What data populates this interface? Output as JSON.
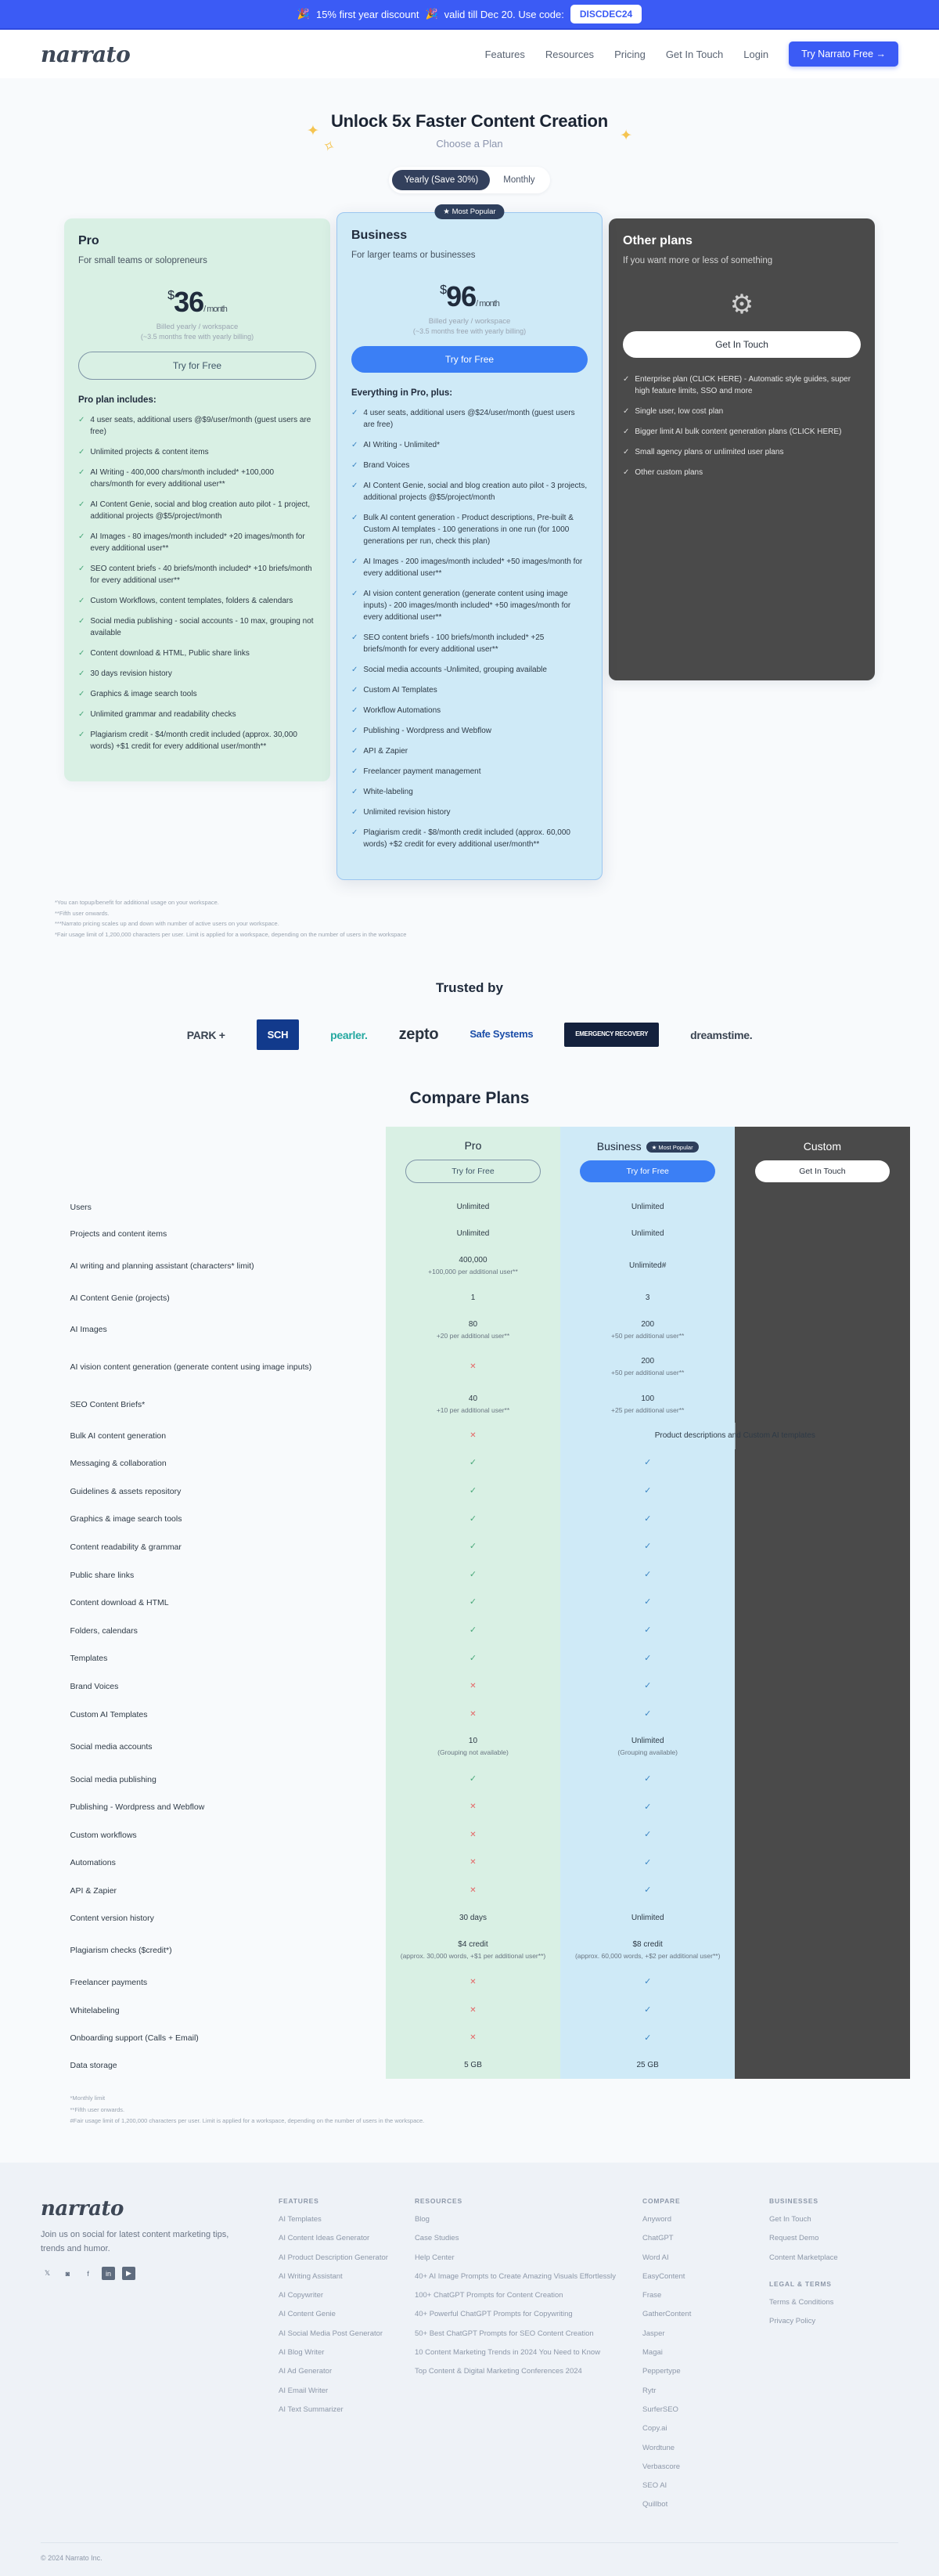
{
  "announcement": {
    "emoji_left": "🎉",
    "text_before": "15% first year discount",
    "emoji_right": "🎉",
    "text_after": "valid till Dec 20. Use code:",
    "code": "DISCDEC24"
  },
  "nav": {
    "logo": "narrato",
    "links": [
      "Features",
      "Resources",
      "Pricing",
      "Get In Touch",
      "Login"
    ],
    "cta": "Try Narrato Free →"
  },
  "hero": {
    "title": "Unlock 5x Faster Content Creation",
    "subtitle": "Choose a Plan",
    "toggle": {
      "yearly": "Yearly (Save 30%)",
      "monthly": "Monthly",
      "active": "yearly"
    }
  },
  "plans": [
    {
      "name": "Pro",
      "tagline": "For small teams or solopreneurs",
      "currency": "$",
      "price": "36",
      "per": "/ month",
      "billed": "Billed yearly / workspace",
      "billed_note": "(~3.5 months free with yearly billing)",
      "cta": "Try for Free",
      "includes_title": "Pro plan includes:",
      "features": [
        "4 user seats, additional users @$9/user/month (guest users are free)",
        "Unlimited projects & content items",
        "AI Writing - 400,000 chars/month included* +100,000 chars/month for every additional user**",
        "AI Content Genie, social and blog creation auto pilot - 1 project, additional projects @$5/project/month",
        "AI Images - 80 images/month included* +20 images/month for every additional user**",
        "SEO content briefs - 40 briefs/month included* +10 briefs/month for every additional user**",
        "Custom Workflows, content templates, folders & calendars",
        "Social media publishing - social accounts - 10 max, grouping not available",
        "Content download & HTML, Public share links",
        "30 days revision history",
        "Graphics & image search tools",
        "Unlimited grammar and readability checks",
        "Plagiarism credit - $4/month credit included (approx. 30,000 words) +$1 credit for every additional user/month**"
      ]
    },
    {
      "name": "Business",
      "badge": "★ Most Popular",
      "tagline": "For larger teams or businesses",
      "currency": "$",
      "price": "96",
      "per": "/ month",
      "billed": "Billed yearly / workspace",
      "billed_note": "(~3.5 months free with yearly billing)",
      "cta": "Try for Free",
      "includes_title": "Everything in Pro, plus:",
      "features": [
        "4 user seats, additional users @$24/user/month (guest users are free)",
        "AI Writing - Unlimited*",
        "Brand Voices",
        "AI Content Genie, social and blog creation auto pilot - 3 projects, additional projects @$5/project/month",
        "Bulk AI content generation - Product descriptions, Pre-built & Custom AI templates - 100 generations in one run (for 1000 generations per run, check this plan)",
        "AI Images - 200 images/month included* +50 images/month for every additional user**",
        "AI vision content generation (generate content using image inputs) - 200 images/month included* +50 images/month for every additional user**",
        "SEO content briefs - 100 briefs/month included* +25 briefs/month for every additional user**",
        "Social media accounts -Unlimited, grouping available",
        "Custom AI Templates",
        "Workflow Automations",
        "Publishing - Wordpress and Webflow",
        "API & Zapier",
        "Freelancer payment management",
        "White-labeling",
        "Unlimited revision history",
        "Plagiarism credit - $8/month credit included (approx. 60,000 words) +$2 credit for every additional user/month**"
      ]
    },
    {
      "name": "Other plans",
      "tagline": "If you want more or less of something",
      "cta": "Get In Touch",
      "features": [
        "Enterprise plan (CLICK HERE) - Automatic style guides, super high feature limits, SSO and more",
        "Single user, low cost plan",
        "Bigger limit AI bulk content generation plans (CLICK HERE)",
        "Small agency plans or unlimited user plans",
        "Other custom plans"
      ]
    }
  ],
  "plan_notes": [
    "*You can topup/benefit for additional usage on your workspace.",
    "**Fifth user onwards.",
    "***Narrato pricing scales up and down with number of active users on your workspace.",
    "*Fair usage limit of 1,200,000 characters per user. Limit is applied for a workspace, depending on the number of users in the workspace"
  ],
  "trusted": {
    "title": "Trusted by",
    "logos": [
      "PARK +",
      "SCH",
      "pearler.",
      "zepto",
      "Safe Systems",
      "EMERGENCY RECOVERY",
      "dreamstime."
    ]
  },
  "compare": {
    "title": "Compare Plans",
    "columns": [
      {
        "name": "Pro",
        "cta": "Try for Free",
        "style": "pro"
      },
      {
        "name": "Business",
        "badge": "★ Most Popular",
        "cta": "Try for Free",
        "style": "bus"
      },
      {
        "name": "Custom",
        "cta": "Get In Touch",
        "style": "oth"
      }
    ],
    "rows": [
      {
        "label": "Users",
        "pro": "Unlimited",
        "bus": "Unlimited",
        "oth": ""
      },
      {
        "label": "Projects and content items",
        "pro": "Unlimited",
        "bus": "Unlimited",
        "oth": ""
      },
      {
        "label": "AI writing and planning assistant (characters* limit)",
        "pro": "400,000",
        "pro_sub": "+100,000 per additional user**",
        "bus": "Unlimited#",
        "oth": ""
      },
      {
        "label": "AI Content Genie (projects)",
        "pro": "1",
        "bus": "3",
        "oth": ""
      },
      {
        "label": "AI Images",
        "pro": "80",
        "pro_sub": "+20 per additional user**",
        "bus": "200",
        "bus_sub": "+50 per additional user**",
        "oth": ""
      },
      {
        "label": "AI vision content generation (generate content using image inputs)",
        "pro": "cross",
        "bus": "200",
        "bus_sub": "+50 per additional user**",
        "oth": ""
      },
      {
        "label": "SEO Content Briefs*",
        "pro": "40",
        "pro_sub": "+10 per additional user**",
        "bus": "100",
        "bus_sub": "+25 per additional user**",
        "oth": ""
      },
      {
        "label": "Bulk AI content generation",
        "pro": "cross",
        "bus": "Product descriptions and Custom AI templates",
        "bus_span": true,
        "oth": ""
      },
      {
        "label": "Messaging & collaboration",
        "pro": "check",
        "bus": "check",
        "oth": ""
      },
      {
        "label": "Guidelines & assets repository",
        "pro": "check",
        "bus": "check",
        "oth": ""
      },
      {
        "label": "Graphics & image search tools",
        "pro": "check",
        "bus": "check",
        "oth": ""
      },
      {
        "label": "Content readability & grammar",
        "pro": "check",
        "bus": "check",
        "oth": ""
      },
      {
        "label": "Public share links",
        "pro": "check",
        "bus": "check",
        "oth": ""
      },
      {
        "label": "Content download & HTML",
        "pro": "check",
        "bus": "check",
        "oth": ""
      },
      {
        "label": "Folders, calendars",
        "pro": "check",
        "bus": "check",
        "oth": ""
      },
      {
        "label": "Templates",
        "pro": "check",
        "bus": "check",
        "oth": ""
      },
      {
        "label": "Brand Voices",
        "pro": "cross",
        "bus": "check",
        "oth": ""
      },
      {
        "label": "Custom AI Templates",
        "pro": "cross",
        "bus": "check",
        "oth": ""
      },
      {
        "label": "Social media accounts",
        "pro": "10",
        "pro_sub": "(Grouping not available)",
        "bus": "Unlimited",
        "bus_sub": "(Grouping available)",
        "oth": ""
      },
      {
        "label": "Social media publishing",
        "pro": "check",
        "bus": "check",
        "oth": ""
      },
      {
        "label": "Publishing - Wordpress and Webflow",
        "pro": "cross",
        "bus": "check",
        "oth": ""
      },
      {
        "label": "Custom workflows",
        "pro": "cross",
        "bus": "check",
        "oth": ""
      },
      {
        "label": "Automations",
        "pro": "cross",
        "bus": "check",
        "oth": ""
      },
      {
        "label": "API & Zapier",
        "pro": "cross",
        "bus": "check",
        "oth": ""
      },
      {
        "label": "Content version history",
        "pro": "30 days",
        "bus": "Unlimited",
        "oth": ""
      },
      {
        "label": "Plagiarism checks ($credit*)",
        "pro": "$4 credit",
        "pro_sub": "(approx. 30,000 words, +$1 per additional user**)",
        "bus": "$8 credit",
        "bus_sub": "(approx. 60,000 words, +$2 per additional user**)",
        "oth": ""
      },
      {
        "label": "Freelancer payments",
        "pro": "cross",
        "bus": "check",
        "oth": ""
      },
      {
        "label": "Whitelabeling",
        "pro": "cross",
        "bus": "check",
        "oth": ""
      },
      {
        "label": "Onboarding support (Calls + Email)",
        "pro": "cross",
        "bus": "check",
        "oth": ""
      },
      {
        "label": "Data storage",
        "pro": "5 GB",
        "bus": "25 GB",
        "oth": ""
      }
    ],
    "notes": [
      "*Monthly limit",
      "**Fifth user onwards.",
      "#Fair usage limit of 1,200,000 characters per user. Limit is applied for a workspace, depending on the number of users in the workspace."
    ]
  },
  "footer": {
    "logo": "narrato",
    "blurb": "Join us on social for latest content marketing tips, trends and humor.",
    "socials": [
      "twitter-icon",
      "instagram-icon",
      "facebook-icon",
      "linkedin-icon",
      "youtube-icon"
    ],
    "columns": [
      {
        "title": "FEATURES",
        "links": [
          "AI Templates",
          "AI Content Ideas Generator",
          "AI Product Description Generator",
          "AI Writing Assistant",
          "AI Copywriter",
          "AI Content Genie",
          "AI Social Media Post Generator",
          "AI Blog Writer",
          "AI Ad Generator",
          "AI Email Writer",
          "AI Text Summarizer"
        ]
      },
      {
        "title": "RESOURCES",
        "links": [
          "Blog",
          "Case Studies",
          "Help Center",
          "40+ AI Image Prompts to Create Amazing Visuals Effortlessly",
          "100+ ChatGPT Prompts for Content Creation",
          "40+ Powerful ChatGPT Prompts for Copywriting",
          "50+ Best ChatGPT Prompts for SEO Content Creation",
          "10 Content Marketing Trends in 2024 You Need to Know",
          "Top Content & Digital Marketing Conferences 2024"
        ]
      },
      {
        "title": "COMPARE",
        "links": [
          "Anyword",
          "ChatGPT",
          "Word AI",
          "EasyContent",
          "Frase",
          "GatherContent",
          "Jasper",
          "Magai",
          "Peppertype",
          "Rytr",
          "SurferSEO",
          "Copy.ai",
          "Wordtune",
          "Verbascore",
          "SEO AI",
          "Quillbot"
        ]
      },
      {
        "title": "BUSINESSES",
        "links": [
          "Get In Touch",
          "Request Demo",
          "Content Marketplace"
        ],
        "title2": "LEGAL & TERMS",
        "links2": [
          "Terms & Conditions",
          "Privacy Policy"
        ]
      }
    ],
    "copyright": "© 2024 Narrato Inc."
  }
}
